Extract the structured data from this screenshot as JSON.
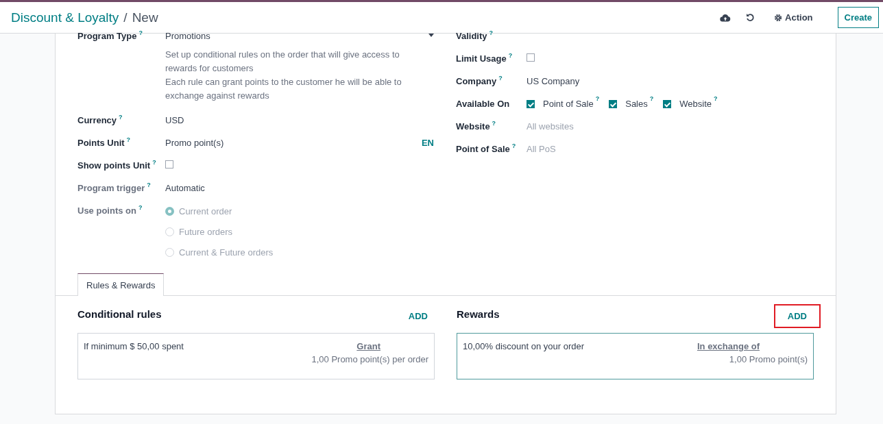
{
  "header": {
    "breadcrumb": "Discount & Loyalty",
    "separator": "/",
    "current": "New",
    "action": "Action",
    "create": "Create"
  },
  "left_fields": [
    {
      "kind": "select",
      "label": "Program Type",
      "help": "?",
      "disabled": false,
      "value": "Promotions",
      "note": [
        "Set up conditional rules on the order that will give access to rewards for customers",
        "Each rule can grant points to the customer he will be able to exchange against rewards"
      ]
    },
    {
      "kind": "text",
      "label": "Currency",
      "help": "?",
      "disabled": false,
      "value": "USD"
    },
    {
      "kind": "translatable",
      "label": "Points Unit",
      "help": "?",
      "disabled": false,
      "value": "Promo point(s)",
      "lang": "EN"
    },
    {
      "kind": "checkbox",
      "label": "Show points Unit",
      "help": "?",
      "disabled": false,
      "checked": false
    },
    {
      "kind": "text",
      "label": "Program trigger",
      "help": "?",
      "disabled": true,
      "value": "Automatic"
    },
    {
      "kind": "radio",
      "label": "Use points on",
      "help": "?",
      "disabled": true,
      "options": [
        {
          "label": "Current order",
          "selected": true
        },
        {
          "label": "Future orders",
          "selected": false
        },
        {
          "label": "Current & Future orders",
          "selected": false
        }
      ]
    }
  ],
  "right_fields": [
    {
      "kind": "text",
      "label": "Validity",
      "help": "?",
      "disabled": false
    },
    {
      "kind": "checkbox",
      "label": "Limit Usage",
      "help": "?",
      "disabled": false,
      "checked": false
    },
    {
      "kind": "text",
      "label": "Company",
      "help": "?",
      "disabled": false,
      "value": "US Company"
    },
    {
      "kind": "checkboxes",
      "label": "Available On",
      "disabled": false,
      "options": [
        {
          "label": "Point of Sale",
          "help": "?",
          "checked": true
        },
        {
          "label": "Sales",
          "help": "?",
          "checked": true
        },
        {
          "label": "Website",
          "help": "?",
          "checked": true
        }
      ]
    },
    {
      "kind": "placeholder",
      "label": "Website",
      "help": "?",
      "disabled": false,
      "placeholder": "All websites"
    },
    {
      "kind": "placeholder",
      "label": "Point of Sale",
      "help": "?",
      "disabled": false,
      "placeholder": "All PoS"
    }
  ],
  "tabs": [
    {
      "label": "Rules & Rewards",
      "selected": true
    }
  ],
  "panels": [
    {
      "title": "Conditional rules",
      "add": "ADD",
      "add_highlighted": false,
      "card_active": false,
      "line": "If minimum $ 50,00 spent",
      "right_title": "Grant",
      "right_value": "1,00 Promo point(s) per order"
    },
    {
      "title": "Rewards",
      "add": "ADD",
      "add_highlighted": true,
      "card_active": true,
      "line": "10,00% discount on your order",
      "right_title": "In exchange of",
      "right_value": "1,00 Promo point(s)"
    }
  ]
}
